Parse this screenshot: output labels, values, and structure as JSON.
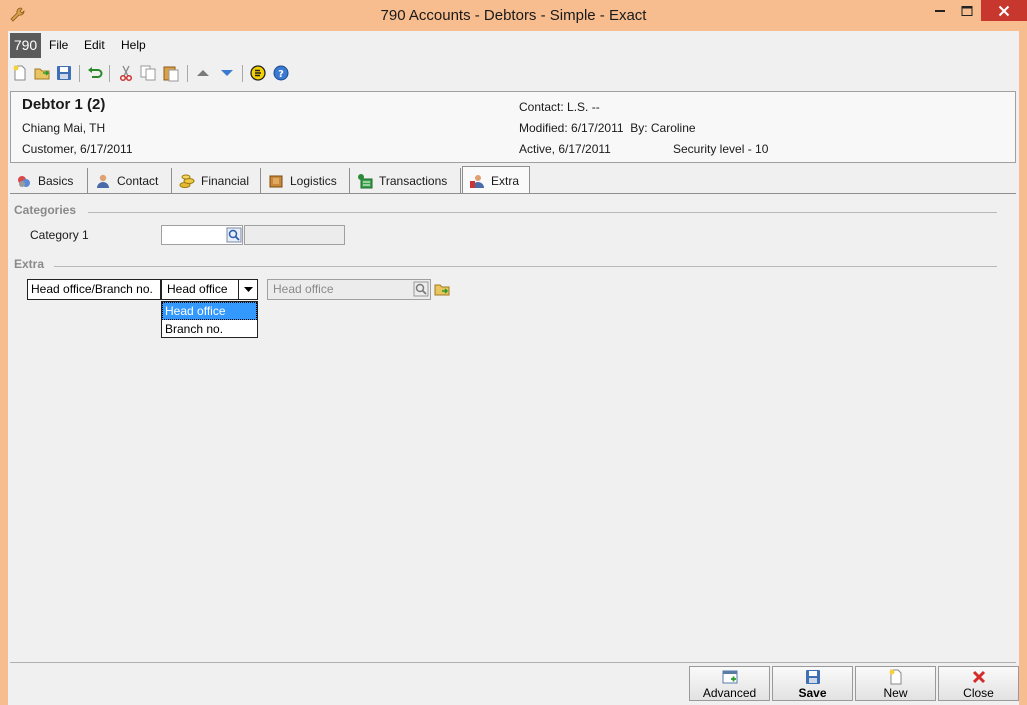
{
  "window": {
    "title": "790 Accounts - Debtors - Simple - Exact"
  },
  "menubar": {
    "app_badge": "790",
    "items": [
      "File",
      "Edit",
      "Help"
    ]
  },
  "toolbar": {
    "icons": [
      "new-icon",
      "open-icon",
      "save-icon",
      "undo-icon",
      "cut-icon",
      "copy-icon",
      "paste-icon",
      "previous-icon",
      "next-icon",
      "exact-icon",
      "help-icon"
    ]
  },
  "header": {
    "title": "Debtor 1 (2)",
    "location": "Chiang Mai, TH",
    "customer": "Customer, 6/17/2011",
    "contact": "Contact: L.S. --",
    "modified": "Modified: 6/17/2011  By: Caroline",
    "active": "Active, 6/17/2011",
    "security": "Security level - 10"
  },
  "tabs": [
    "Basics",
    "Contact",
    "Financial",
    "Logistics",
    "Transactions",
    "Extra"
  ],
  "active_tab": "Extra",
  "categories": {
    "section_label": "Categories",
    "category1_label": "Category 1",
    "category1_value": "",
    "category1_desc": ""
  },
  "extra": {
    "section_label": "Extra",
    "field_label": "Head office/Branch no.",
    "combo_value": "Head office",
    "lookup_placeholder": "Head office",
    "options": [
      "Head office",
      "Branch no."
    ],
    "selected_option": "Head office"
  },
  "buttons": {
    "advanced": "Advanced",
    "save": "Save",
    "new": "New",
    "close": "Close"
  },
  "colors": {
    "titlebar": "#f7bd8f",
    "close_button": "#c7372d",
    "selection": "#3399ff"
  }
}
